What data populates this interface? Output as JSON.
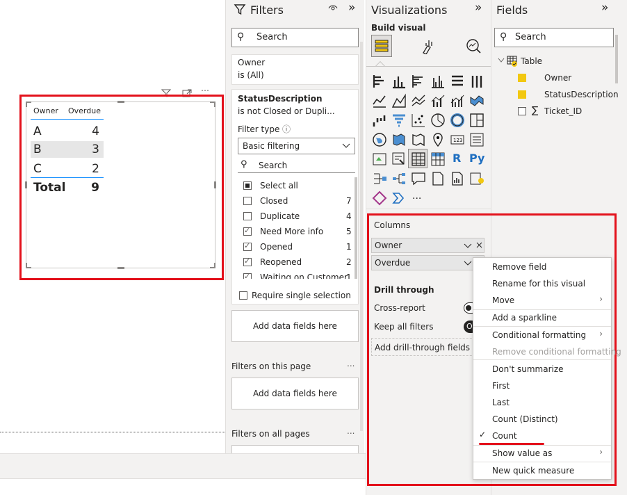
{
  "canvas": {
    "table": {
      "headers": [
        "Owner",
        "Overdue"
      ],
      "rows": [
        {
          "owner": "A",
          "overdue": "4"
        },
        {
          "owner": "B",
          "overdue": "3"
        },
        {
          "owner": "C",
          "overdue": "2"
        }
      ],
      "total_label": "Total",
      "total_value": "9"
    }
  },
  "filters": {
    "title": "Filters",
    "search_placeholder": "Search",
    "owner_card": {
      "field": "Owner",
      "state": "is (All)"
    },
    "status_card": {
      "field": "StatusDescription",
      "state": "is not Closed or Dupli...",
      "filter_type_label": "Filter type",
      "filter_type_value": "Basic filtering",
      "search_placeholder": "Search",
      "items": [
        {
          "label": "Select all",
          "count": "",
          "state": "partial"
        },
        {
          "label": "Closed",
          "count": "7",
          "state": "unchecked"
        },
        {
          "label": "Duplicate",
          "count": "4",
          "state": "unchecked"
        },
        {
          "label": "Need More info",
          "count": "5",
          "state": "checked"
        },
        {
          "label": "Opened",
          "count": "1",
          "state": "checked"
        },
        {
          "label": "Reopened",
          "count": "2",
          "state": "checked"
        },
        {
          "label": "Waiting on Customer",
          "count": "1",
          "state": "checked"
        }
      ],
      "require_single": "Require single selection"
    },
    "add_data_fields_1": "Add data fields here",
    "page_section": "Filters on this page",
    "add_data_fields_2": "Add data fields here",
    "all_pages_section": "Filters on all pages",
    "more_glyph": "..."
  },
  "visualizations": {
    "title": "Visualizations",
    "build_visual": "Build visual",
    "icon_labels": {
      "r": "R",
      "py": "Py",
      "more": "...",
      "num": "123"
    },
    "columns_label": "Columns",
    "wells": [
      {
        "label": "Owner"
      },
      {
        "label": "Overdue"
      }
    ],
    "drill_through": "Drill through",
    "cross_report": "Cross-report",
    "keep_all_filters": "Keep all filters",
    "keep_toggle_text": "O",
    "add_drill": "Add drill-through fields he"
  },
  "fields": {
    "title": "Fields",
    "search_placeholder": "Search",
    "table_name": "Table",
    "items": [
      {
        "label": "Owner",
        "checked": true
      },
      {
        "label": "StatusDescription",
        "checked": true
      },
      {
        "label": "Ticket_ID",
        "checked": false
      }
    ],
    "sigma": "∑"
  },
  "context_menu": {
    "items": [
      {
        "label": "Remove field"
      },
      {
        "label": "Rename for this visual"
      },
      {
        "label": "Move"
      },
      {
        "label": "Add a sparkline"
      },
      {
        "label": "Conditional formatting"
      },
      {
        "label": "Remove conditional formatting"
      },
      {
        "label": "Don't summarize"
      },
      {
        "label": "First"
      },
      {
        "label": "Last"
      },
      {
        "label": "Count (Distinct)"
      },
      {
        "label": "Count"
      },
      {
        "label": "Show value as"
      },
      {
        "label": "New quick measure"
      }
    ]
  },
  "colors": {
    "accent_red": "#e3111b",
    "field_check": "#f2c811"
  }
}
